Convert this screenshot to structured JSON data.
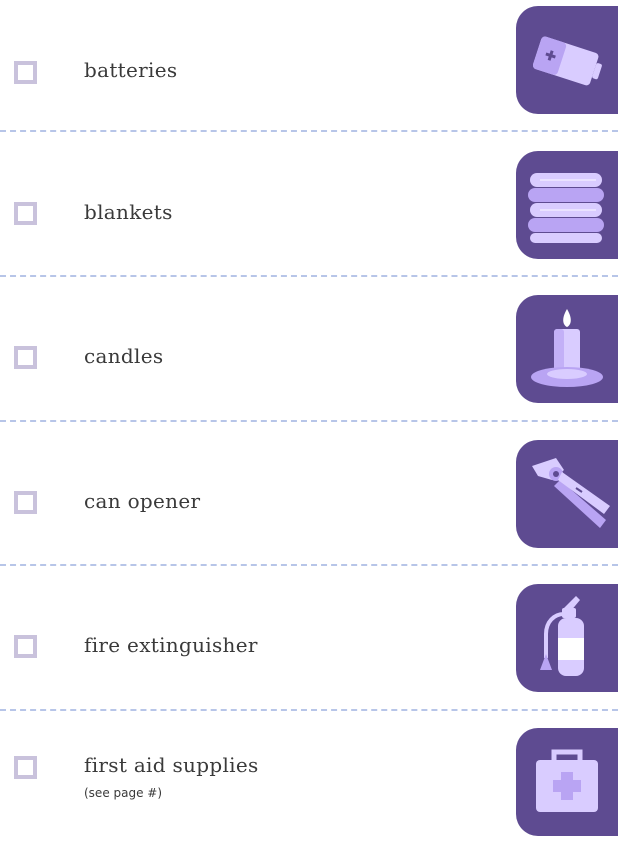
{
  "checklist": {
    "items": [
      {
        "label": "batteries",
        "icon": "battery-icon",
        "checked": false
      },
      {
        "label": "blankets",
        "icon": "blankets-icon",
        "checked": false
      },
      {
        "label": "candles",
        "icon": "candle-icon",
        "checked": false
      },
      {
        "label": "can opener",
        "icon": "can-opener-icon",
        "checked": false
      },
      {
        "label": "fire extinguisher",
        "icon": "fire-extinguisher-icon",
        "checked": false
      },
      {
        "label": "first aid supplies",
        "note": "(see page #)",
        "icon": "first-aid-kit-icon",
        "checked": false
      }
    ]
  },
  "colors": {
    "tile_background": "#5e4b91",
    "icon_light": "#d9ccff",
    "icon_mid": "#b9a4f3",
    "checkbox_border": "#c9c2dc",
    "divider": "#b7c5e8",
    "text": "#3a3a3a"
  }
}
